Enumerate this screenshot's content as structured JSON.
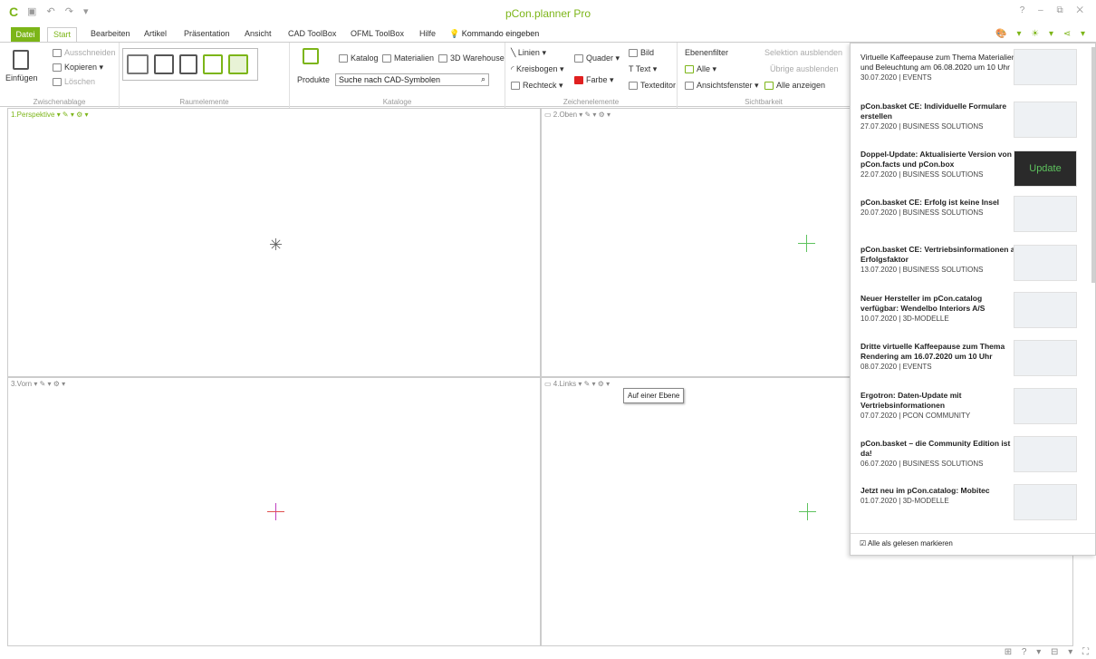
{
  "app": {
    "title": "pCon.planner Pro"
  },
  "tabs": [
    "Datei",
    "Start",
    "Bearbeiten",
    "Artikel",
    "Präsentation",
    "Ansicht",
    "CAD ToolBox",
    "OFML ToolBox",
    "Hilfe"
  ],
  "command": "Kommando eingeben",
  "ribbon": {
    "clipboard": {
      "paste": "Einfügen",
      "cut": "Ausschneiden",
      "copy": "Kopieren",
      "delete": "Löschen",
      "label": "Zwischenablage"
    },
    "rooms": {
      "label": "Raumelemente"
    },
    "catalogs": {
      "products": "Produkte",
      "catalog": "Katalog",
      "materials": "Materialien",
      "warehouse": "3D Warehouse",
      "search_placeholder": "Suche nach CAD-Symbolen",
      "label": "Kataloge"
    },
    "drawing": {
      "lines": "Linien",
      "arc": "Kreisbogen",
      "rect": "Rechteck",
      "box": "Quader",
      "color": "Farbe",
      "image": "Bild",
      "text": "Text",
      "texteditor": "Texteditor",
      "label": "Zeichenelemente"
    },
    "visibility": {
      "layerfilter": "Ebenenfilter",
      "all": "Alle",
      "viewwindow": "Ansichtsfenster",
      "showall": "Alle anzeigen",
      "hidesel": "Selektion ausblenden",
      "hideother": "Übrige ausblenden",
      "label": "Sichtbarkeit"
    }
  },
  "viewports": [
    "1.Perspektive",
    "2.Oben",
    "3.Vorn",
    "4.Links"
  ],
  "tooltip": "Auf einer Ebene",
  "news": [
    {
      "title": "Virtuelle Kaffeepause zum Thema Materialien und Beleuchtung am 06.08.2020 um 10 Uhr",
      "date": "30.07.2020 | EVENTS"
    },
    {
      "title": "pCon.basket CE: Individuelle Formulare erstellen",
      "date": "27.07.2020 | BUSINESS SOLUTIONS"
    },
    {
      "title": "Doppel-Update: Aktualisierte Version von pCon.facts und pCon.box",
      "date": "22.07.2020 | BUSINESS SOLUTIONS"
    },
    {
      "title": "pCon.basket CE: Erfolg ist keine Insel",
      "date": "20.07.2020 | BUSINESS SOLUTIONS"
    },
    {
      "title": "pCon.basket CE: Vertriebsinformationen als Erfolgsfaktor",
      "date": "13.07.2020 | BUSINESS SOLUTIONS"
    },
    {
      "title": "Neuer Hersteller im pCon.catalog verfügbar: Wendelbo Interiors A/S",
      "date": "10.07.2020 | 3D-MODELLE"
    },
    {
      "title": "Dritte virtuelle Kaffeepause zum Thema Rendering am 16.07.2020 um 10 Uhr",
      "date": "08.07.2020 | EVENTS"
    },
    {
      "title": "Ergotron: Daten-Update mit Vertriebsinformationen",
      "date": "07.07.2020 | PCON COMMUNITY"
    },
    {
      "title": "pCon.basket – die Community Edition ist da!",
      "date": "06.07.2020 | BUSINESS SOLUTIONS"
    },
    {
      "title": "Jetzt neu im pCon.catalog: Mobitec",
      "date": "01.07.2020 | 3D-MODELLE"
    }
  ],
  "update_thumb": "Update",
  "mark_all_read": "Alle als gelesen markieren"
}
